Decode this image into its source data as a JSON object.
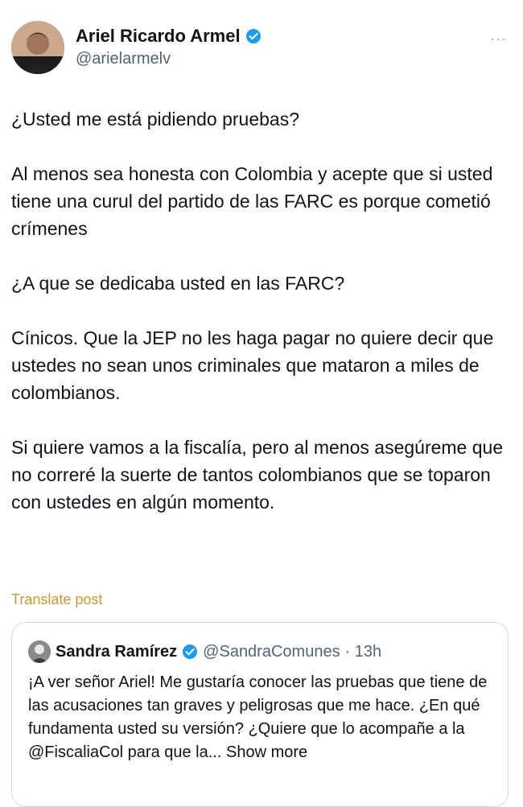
{
  "author": {
    "name": "Ariel Ricardo Armel",
    "handle": "@arielarmelv",
    "verified": true
  },
  "more_icon": "more-horizontal-icon",
  "more_label": "···",
  "tweet": {
    "paragraphs": [
      "¿Usted me está pidiendo pruebas?",
      "Al menos sea honesta con Colombia y acepte que si usted tiene una curul del partido de las FARC es porque cometió crímenes",
      "¿A que se dedicaba usted en las FARC?",
      "Cínicos. Que la JEP no les haga pagar no quiere decir que ustedes no sean unos criminales que mataron a miles de colombianos.",
      "Si quiere vamos a la fiscalía, pero al menos asegúreme que no correré la suerte de tantos colombianos que se toparon con ustedes en algún momento."
    ]
  },
  "translate_label": "Translate post",
  "quote": {
    "name": "Sandra Ramírez",
    "handle": "@SandraComunes",
    "time": "· 13h",
    "verified": true,
    "text": "¡A ver señor Ariel! Me gustaría conocer las pruebas que tiene de las acusaciones tan graves y peligrosas que me hace. ¿En qué fundamenta usted su versión? ¿Quiere que lo acompañe a la @FiscaliaCol para que la...",
    "show_more": "Show more"
  },
  "colors": {
    "text": "#0f1419",
    "secondary": "#536471",
    "verified_blue": "#1d9bf0",
    "translate": "#c79a2e",
    "border": "#cfd9de"
  }
}
